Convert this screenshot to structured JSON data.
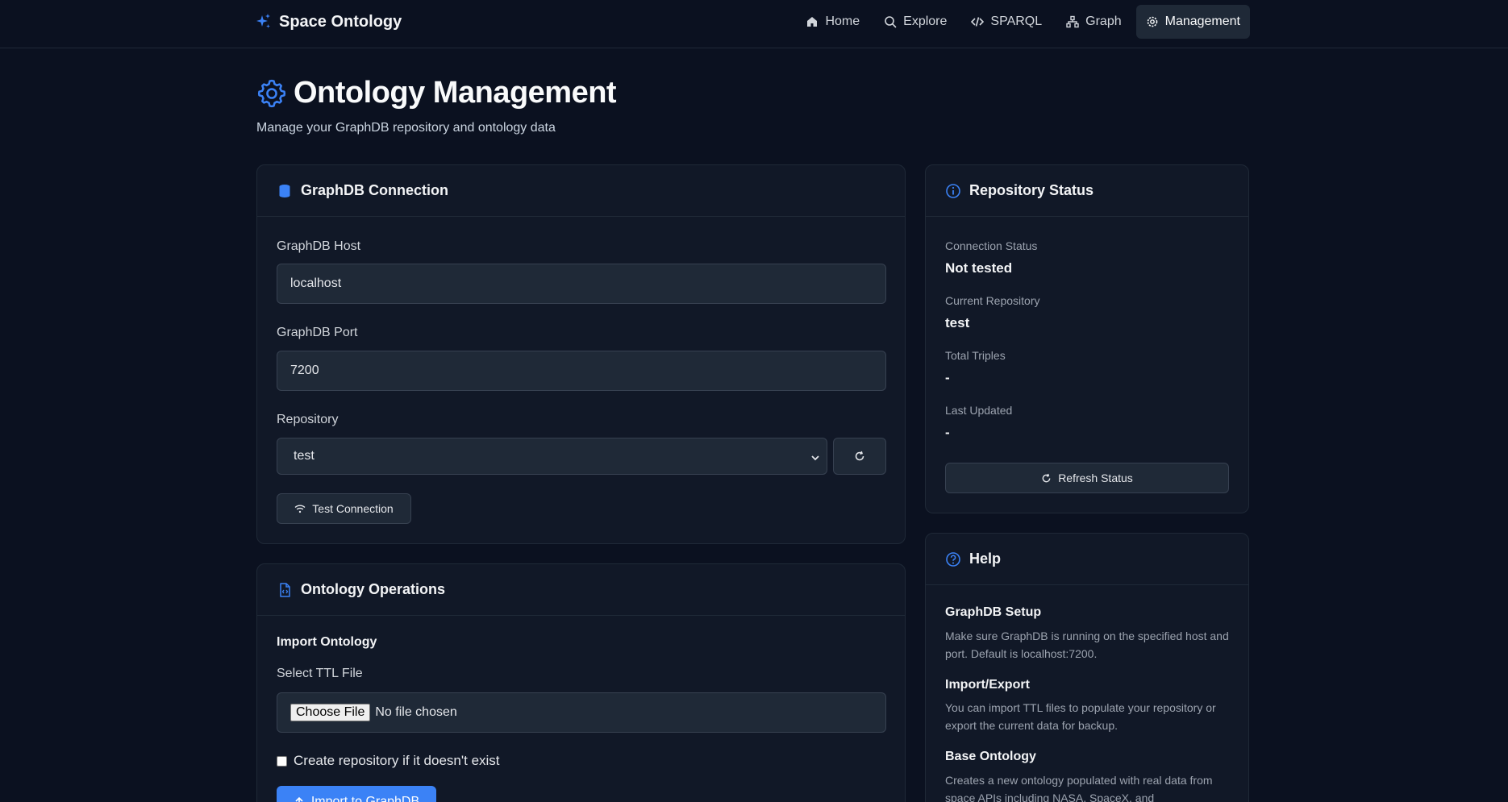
{
  "brand": {
    "name": "Space Ontology",
    "icon": "sparkles-icon",
    "accent": "#3b82f6"
  },
  "nav": [
    {
      "label": "Home",
      "icon": "home-icon",
      "active": false
    },
    {
      "label": "Explore",
      "icon": "search-icon",
      "active": false
    },
    {
      "label": "SPARQL",
      "icon": "code-icon",
      "active": false
    },
    {
      "label": "Graph",
      "icon": "network-icon",
      "active": false
    },
    {
      "label": "Management",
      "icon": "gear-icon",
      "active": true
    }
  ],
  "header": {
    "title": "Ontology Management",
    "subtitle": "Manage your GraphDB repository and ontology data"
  },
  "connection": {
    "title": "GraphDB Connection",
    "host_label": "GraphDB Host",
    "host_value": "localhost",
    "port_label": "GraphDB Port",
    "port_value": "7200",
    "repo_label": "Repository",
    "repo_value": "test",
    "test_button": "Test Connection"
  },
  "operations": {
    "title": "Ontology Operations",
    "import_heading": "Import Ontology",
    "file_label": "Select TTL File",
    "file_button": "Choose File",
    "file_status": "No file chosen",
    "create_repo_label": "Create repository if it doesn't exist",
    "create_repo_checked": false,
    "import_button": "Import to GraphDB"
  },
  "status": {
    "title": "Repository Status",
    "connection_label": "Connection Status",
    "connection_value": "Not tested",
    "repo_label": "Current Repository",
    "repo_value": "test",
    "triples_label": "Total Triples",
    "triples_value": "-",
    "updated_label": "Last Updated",
    "updated_value": "-",
    "refresh_button": "Refresh Status"
  },
  "help": {
    "title": "Help",
    "sections": [
      {
        "title": "GraphDB Setup",
        "text": "Make sure GraphDB is running on the specified host and port. Default is localhost:7200."
      },
      {
        "title": "Import/Export",
        "text": "You can import TTL files to populate your repository or export the current data for backup."
      },
      {
        "title": "Base Ontology",
        "text": "Creates a new ontology populated with real data from space APIs including NASA, SpaceX, and"
      }
    ]
  }
}
